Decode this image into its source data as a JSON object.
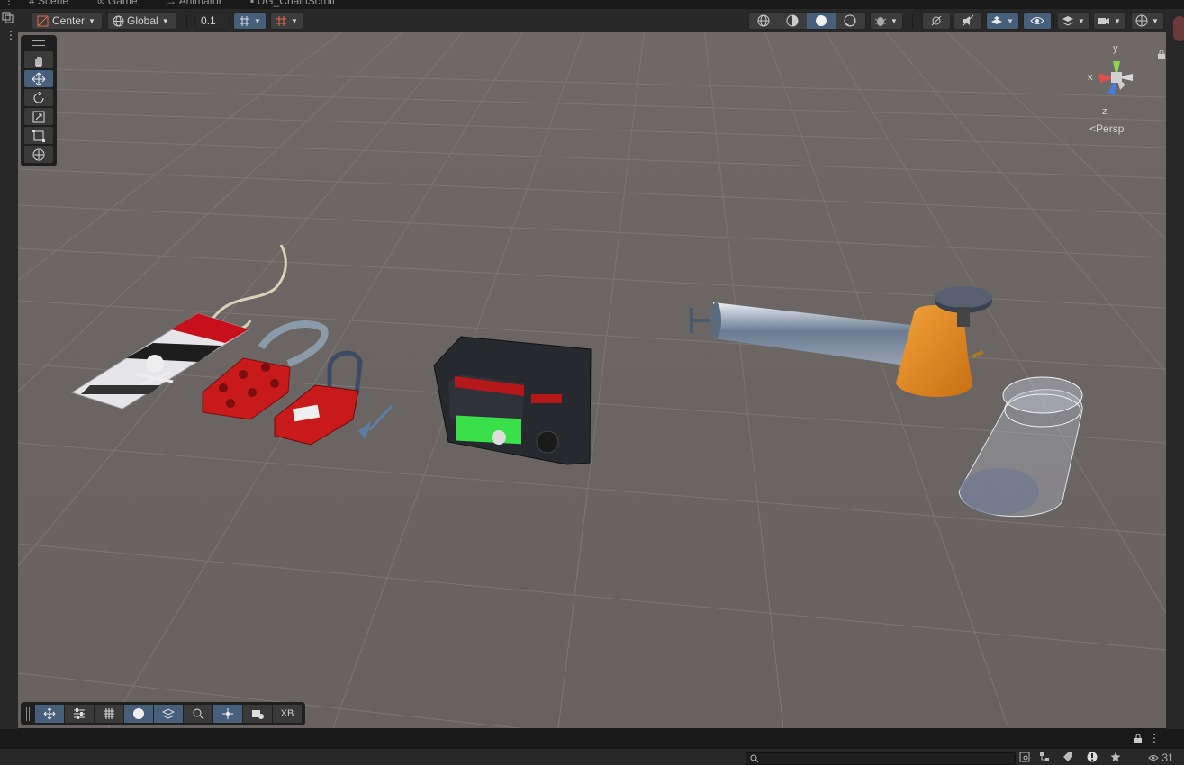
{
  "tabs": [
    {
      "label": "Scene",
      "icon": "hash-icon"
    },
    {
      "label": "Game",
      "icon": "gamepad-icon"
    },
    {
      "label": "Animator",
      "icon": "animator-icon"
    },
    {
      "label": "UG_ChainScroll",
      "icon": "script-icon"
    }
  ],
  "toolbar": {
    "pivot_mode": "Center",
    "pivot_rotation": "Global",
    "grid_snap_value": "0.1"
  },
  "tools": [
    "hand-tool",
    "move-tool",
    "rotate-tool",
    "scale-tool",
    "rect-tool",
    "transform-tool"
  ],
  "active_tool": "move-tool",
  "overlay_toolbar": {
    "buttons": [
      "move",
      "settings",
      "grid",
      "sphere",
      "layers",
      "search",
      "pivot",
      "camera",
      "XB"
    ],
    "xb_label": "XB"
  },
  "gizmo": {
    "axis_y": "y",
    "axis_x": "x",
    "axis_z": "z",
    "projection": "Persp"
  },
  "statusbar": {
    "search_placeholder": "",
    "count": "31"
  },
  "colors": {
    "accent": "#46607c",
    "viewport_bg": "#6b6462",
    "panel": "#282828"
  }
}
